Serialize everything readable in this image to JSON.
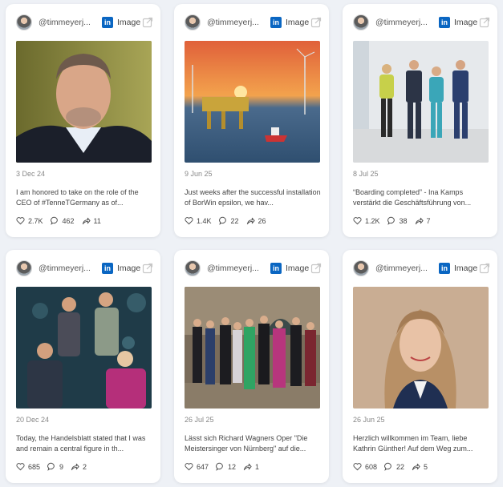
{
  "cards": [
    {
      "handle": "@timmeyerj...",
      "network_badge": "in",
      "type_label": "Image",
      "date": "3 Dec 24",
      "caption": "I am honored to take on the role of the CEO of #TenneTGermany as of...",
      "likes": "2.7K",
      "comments": "462",
      "shares": "11",
      "image_icon": "portrait-photo"
    },
    {
      "handle": "@timmeyerj...",
      "network_badge": "in",
      "type_label": "Image",
      "date": "9 Jun 25",
      "caption": "Just weeks after the successful installation of BorWin epsilon, we hav...",
      "likes": "1.4K",
      "comments": "22",
      "shares": "26",
      "image_icon": "offshore-platform-photo"
    },
    {
      "handle": "@timmeyerj...",
      "network_badge": "in",
      "type_label": "Image",
      "date": "8 Jul 25",
      "caption": "“Boarding completed” - Ina Kamps verstärkt die Geschäftsführung von...",
      "likes": "1.2K",
      "comments": "38",
      "shares": "7",
      "image_icon": "group-photo"
    },
    {
      "handle": "@timmeyerj...",
      "network_badge": "in",
      "type_label": "Image",
      "date": "20 Dec 24",
      "caption": "Today, the Handelsblatt stated that I was and remain a central figure in th...",
      "likes": "685",
      "comments": "9",
      "shares": "2",
      "image_icon": "group-photo"
    },
    {
      "handle": "@timmeyerj...",
      "network_badge": "in",
      "type_label": "Image",
      "date": "26 Jul 25",
      "caption": "Lässt sich Richard Wagners Oper \"Die Meistersinger von Nürnberg\" auf die...",
      "likes": "647",
      "comments": "12",
      "shares": "1",
      "image_icon": "event-group-photo"
    },
    {
      "handle": "@timmeyerj...",
      "network_badge": "in",
      "type_label": "Image",
      "date": "26 Jun 25",
      "caption": "Herzlich willkommen im Team, liebe Kathrin Günther! Auf dem Weg zum...",
      "likes": "608",
      "comments": "22",
      "shares": "5",
      "image_icon": "portrait-photo"
    }
  ],
  "colors": {
    "background": "#eef1f6",
    "card": "#ffffff",
    "linkedin": "#0a66c2"
  }
}
